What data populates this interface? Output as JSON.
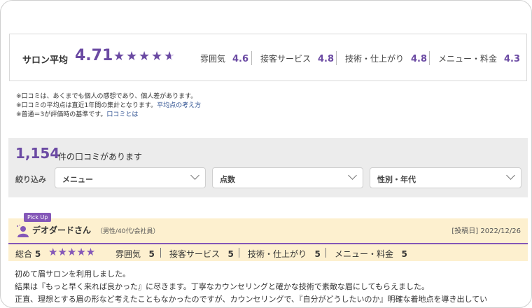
{
  "summary": {
    "label": "サロン平均",
    "score": "4.71",
    "stars": [
      "★",
      "★",
      "★",
      "★",
      "★"
    ],
    "categories": [
      {
        "name": "雰囲気",
        "value": "4.6"
      },
      {
        "name": "接客サービス",
        "value": "4.8"
      },
      {
        "name": "技術・仕上がり",
        "value": "4.8"
      },
      {
        "name": "メニュー・料金",
        "value": "4.3"
      }
    ]
  },
  "notes": {
    "line1": "※口コミは、あくまでも個人の感想であり、個人差があります。",
    "line2": "※口コミの平均点は直近1年間の集計となります。",
    "line2_link": "平均点の考え方",
    "line3": "※普通＝3が評価時の基準です。",
    "line3_link": "口コミとは"
  },
  "reviews_count": {
    "number": "1,154",
    "text": "件の口コミがあります"
  },
  "filter": {
    "label": "絞り込み",
    "menu": "メニュー",
    "score": "点数",
    "gender_age": "性別・年代"
  },
  "review": {
    "badge": "Pick Up",
    "name": "デオダードさん",
    "attributes": "（男性/40代/会社員）",
    "date": "[投稿日] 2022/12/26",
    "overall_label": "総合",
    "overall_value": "5",
    "stars": "★★★★★",
    "ratings": [
      {
        "name": "雰囲気",
        "value": "5"
      },
      {
        "name": "接客サービス",
        "value": "5"
      },
      {
        "name": "技術・仕上がり",
        "value": "5"
      },
      {
        "name": "メニュー・料金",
        "value": "5"
      }
    ],
    "body": [
      "初めて眉サロンを利用しました。",
      "結果は『もっと早く来れば良かった』に尽きます。丁寧なカウンセリングと確かな技術で素敵な眉にしてもらえました。",
      "正直、理想とする眉の形など考えたこともなかったのですが、カウンセリングで、『自分がどうしたいのか』明確な着地点を導き出してい"
    ]
  },
  "colors": {
    "accent": "#6b4aa3",
    "highlight_bg": "#fdf0cf",
    "filter_bg": "#ececec"
  }
}
